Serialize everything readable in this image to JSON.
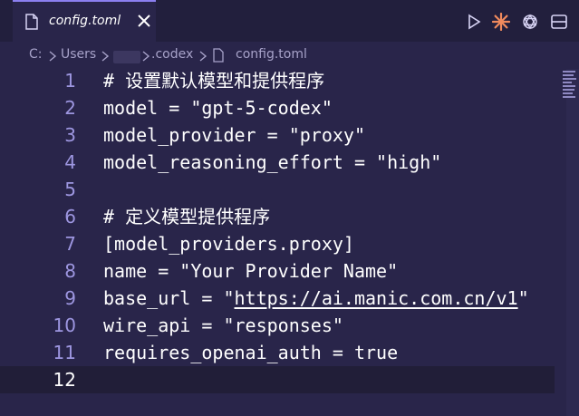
{
  "tab": {
    "title": "config.toml",
    "close_glyph": "✕"
  },
  "breadcrumb": {
    "items": [
      "C:",
      "Users",
      ".codex",
      "config.toml"
    ]
  },
  "editor": {
    "lines": [
      {
        "n": "1",
        "text": "# 设置默认模型和提供程序"
      },
      {
        "n": "2",
        "text": "model = \"gpt-5-codex\""
      },
      {
        "n": "3",
        "text": "model_provider = \"proxy\""
      },
      {
        "n": "4",
        "text": "model_reasoning_effort = \"high\""
      },
      {
        "n": "5",
        "text": ""
      },
      {
        "n": "6",
        "text": "# 定义模型提供程序"
      },
      {
        "n": "7",
        "text": "[model_providers.proxy]"
      },
      {
        "n": "8",
        "text": "name = \"Your Provider Name\""
      },
      {
        "n": "9",
        "text_pre": "base_url = \"",
        "text_url": "https://ai.manic.com.cn/v1",
        "text_post": "\""
      },
      {
        "n": "10",
        "text": "wire_api = \"responses\""
      },
      {
        "n": "11",
        "text": "requires_openai_auth = true"
      },
      {
        "n": "12",
        "text": ""
      }
    ]
  },
  "colors": {
    "editor_bg": "#29254a",
    "line_number": "#9d96e0",
    "text": "#ffffff",
    "accent_icon": "#f08a5d"
  },
  "icons": [
    "file-icon",
    "close-icon",
    "run-icon",
    "spark-icon",
    "openai-icon",
    "split-editor-icon",
    "chevron-right-icon"
  ]
}
